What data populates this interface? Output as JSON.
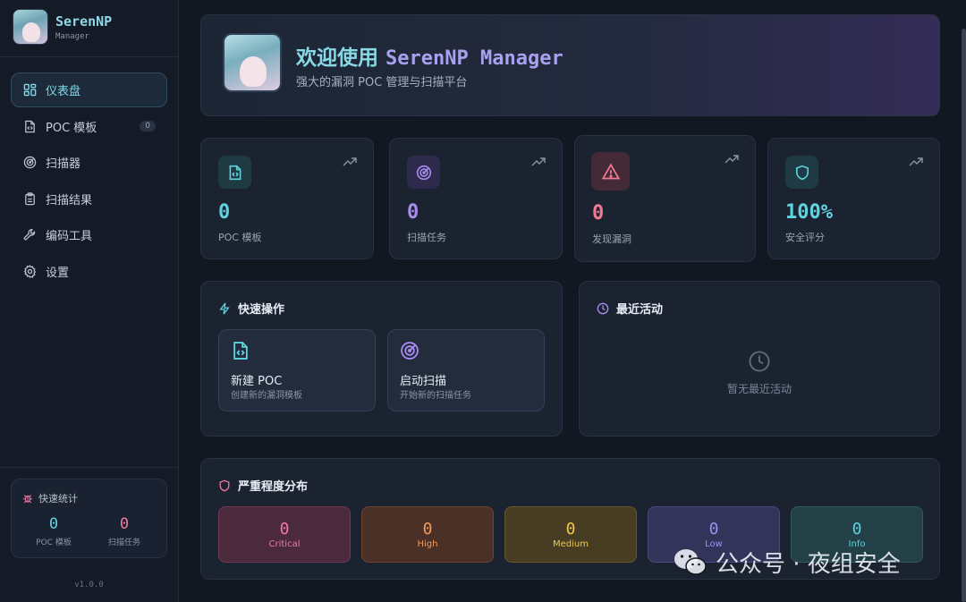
{
  "brand": {
    "title": "SerenNP",
    "subtitle": "Manager"
  },
  "nav": [
    {
      "label": "仪表盘",
      "icon": "dashboard-icon",
      "active": true
    },
    {
      "label": "POC 模板",
      "icon": "file-code-icon",
      "badge": "0"
    },
    {
      "label": "扫描器",
      "icon": "radar-icon"
    },
    {
      "label": "扫描结果",
      "icon": "clipboard-icon"
    },
    {
      "label": "编码工具",
      "icon": "wrench-icon"
    },
    {
      "label": "设置",
      "icon": "gear-icon"
    }
  ],
  "quick_stats": {
    "title": "快速统计",
    "items": [
      {
        "value": "0",
        "label": "POC 模板",
        "color": "#5fd4e0"
      },
      {
        "value": "0",
        "label": "扫描任务",
        "color": "#f07aa0"
      }
    ]
  },
  "version": "v1.0.0",
  "hero": {
    "title_cn": "欢迎使用 ",
    "title_en": "SerenNP Manager",
    "subtitle": "强大的漏洞 POC 管理与扫描平台"
  },
  "stats": [
    {
      "value": "0",
      "label": "POC 模板",
      "color": "#5fd4e0",
      "icon": "file-code-icon"
    },
    {
      "value": "0",
      "label": "扫描任务",
      "color": "#a98cf2",
      "icon": "radar-icon"
    },
    {
      "value": "0",
      "label": "发现漏洞",
      "color": "#f07a92",
      "icon": "warning-triangle-icon"
    },
    {
      "value": "100%",
      "label": "安全评分",
      "color": "#5fd4e0",
      "icon": "shield-icon"
    }
  ],
  "quick_actions": {
    "title": "快速操作",
    "items": [
      {
        "title": "新建 POC",
        "subtitle": "创建新的漏洞模板",
        "icon": "file-code-icon"
      },
      {
        "title": "启动扫描",
        "subtitle": "开始新的扫描任务",
        "icon": "radar-icon"
      }
    ]
  },
  "recent": {
    "title": "最近活动",
    "empty": "暂无最近活动"
  },
  "severity": {
    "title": "严重程度分布",
    "items": [
      {
        "value": "0",
        "label": "Critical",
        "color": "#f07aa0",
        "bg": "#4a2a3c",
        "border": "#6e3a52"
      },
      {
        "value": "0",
        "label": "High",
        "color": "#f59a58",
        "bg": "#4a3026",
        "border": "#6e4430"
      },
      {
        "value": "0",
        "label": "Medium",
        "color": "#f2c84a",
        "bg": "#463d22",
        "border": "#66572c"
      },
      {
        "value": "0",
        "label": "Low",
        "color": "#9a92f0",
        "bg": "#33345a",
        "border": "#4a4a7e"
      },
      {
        "value": "0",
        "label": "Info",
        "color": "#5fd4e0",
        "bg": "#234046",
        "border": "#2f5a60"
      }
    ]
  },
  "watermark": "公众号 · 夜组安全"
}
